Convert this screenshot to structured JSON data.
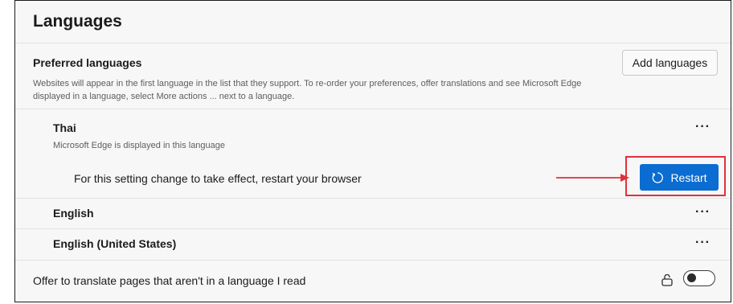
{
  "section": {
    "title": "Languages"
  },
  "preferred": {
    "label": "Preferred languages",
    "description": "Websites will appear in the first language in the list that they support. To re-order your preferences, offer translations and see Microsoft Edge displayed in a language, select More actions ... next to a language.",
    "add_button": "Add languages"
  },
  "languages": [
    {
      "name": "Thai",
      "sub": "Microsoft Edge is displayed in this language",
      "more": "···"
    },
    {
      "name": "English",
      "more": "···"
    },
    {
      "name": "English (United States)",
      "more": "···"
    }
  ],
  "restart": {
    "message": "For this setting change to take effect, restart your browser",
    "button": "Restart",
    "button_color": "#0b6cd1",
    "highlight_color": "#e0313a"
  },
  "offer_translate": {
    "label": "Offer to translate pages that aren't in a language I read",
    "toggle_on": false,
    "lock_icon": "lock-icon"
  }
}
